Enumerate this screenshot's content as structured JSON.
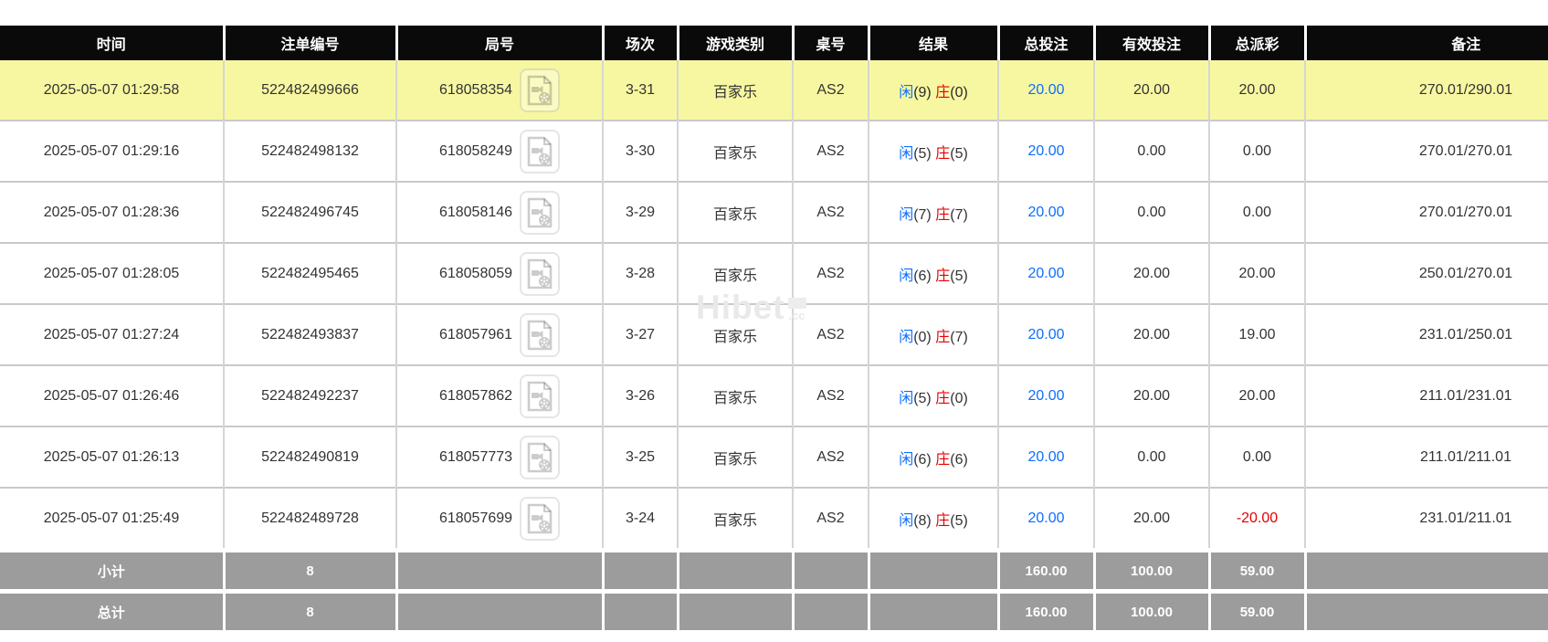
{
  "colors": {
    "header_bg": "#0a0a0a",
    "header_text": "#ffffff",
    "highlight_row": "#f7f7a1",
    "footer_bg": "#9c9c9c",
    "accent_blue": "#0d6efd",
    "accent_red": "#e60000",
    "body_text": "#333333"
  },
  "watermark": {
    "brand": "Hibet",
    "suffix": ".cc"
  },
  "table": {
    "columns": [
      "时间",
      "注单编号",
      "局号",
      "场次",
      "游戏类别",
      "桌号",
      "结果",
      "总投注",
      "有效投注",
      "总派彩",
      "备注"
    ],
    "result_labels": {
      "player": "闲",
      "banker": "庄"
    },
    "rows": [
      {
        "highlight": true,
        "time": "2025-05-07 01:29:58",
        "bet_no": "522482499666",
        "round_no": "618058354",
        "session": "3-31",
        "game_type": "百家乐",
        "table_no": "AS2",
        "player_score": "9",
        "banker_score": "0",
        "total_bet": "20.00",
        "valid_bet": "20.00",
        "payout": "20.00",
        "remark": "270.01/290.01"
      },
      {
        "highlight": false,
        "time": "2025-05-07 01:29:16",
        "bet_no": "522482498132",
        "round_no": "618058249",
        "session": "3-30",
        "game_type": "百家乐",
        "table_no": "AS2",
        "player_score": "5",
        "banker_score": "5",
        "total_bet": "20.00",
        "valid_bet": "0.00",
        "payout": "0.00",
        "remark": "270.01/270.01"
      },
      {
        "highlight": false,
        "time": "2025-05-07 01:28:36",
        "bet_no": "522482496745",
        "round_no": "618058146",
        "session": "3-29",
        "game_type": "百家乐",
        "table_no": "AS2",
        "player_score": "7",
        "banker_score": "7",
        "total_bet": "20.00",
        "valid_bet": "0.00",
        "payout": "0.00",
        "remark": "270.01/270.01"
      },
      {
        "highlight": false,
        "time": "2025-05-07 01:28:05",
        "bet_no": "522482495465",
        "round_no": "618058059",
        "session": "3-28",
        "game_type": "百家乐",
        "table_no": "AS2",
        "player_score": "6",
        "banker_score": "5",
        "total_bet": "20.00",
        "valid_bet": "20.00",
        "payout": "20.00",
        "remark": "250.01/270.01"
      },
      {
        "highlight": false,
        "time": "2025-05-07 01:27:24",
        "bet_no": "522482493837",
        "round_no": "618057961",
        "session": "3-27",
        "game_type": "百家乐",
        "table_no": "AS2",
        "player_score": "0",
        "banker_score": "7",
        "total_bet": "20.00",
        "valid_bet": "20.00",
        "payout": "19.00",
        "remark": "231.01/250.01"
      },
      {
        "highlight": false,
        "time": "2025-05-07 01:26:46",
        "bet_no": "522482492237",
        "round_no": "618057862",
        "session": "3-26",
        "game_type": "百家乐",
        "table_no": "AS2",
        "player_score": "5",
        "banker_score": "0",
        "total_bet": "20.00",
        "valid_bet": "20.00",
        "payout": "20.00",
        "remark": "211.01/231.01"
      },
      {
        "highlight": false,
        "time": "2025-05-07 01:26:13",
        "bet_no": "522482490819",
        "round_no": "618057773",
        "session": "3-25",
        "game_type": "百家乐",
        "table_no": "AS2",
        "player_score": "6",
        "banker_score": "6",
        "total_bet": "20.00",
        "valid_bet": "0.00",
        "payout": "0.00",
        "remark": "211.01/211.01"
      },
      {
        "highlight": false,
        "time": "2025-05-07 01:25:49",
        "bet_no": "522482489728",
        "round_no": "618057699",
        "session": "3-24",
        "game_type": "百家乐",
        "table_no": "AS2",
        "player_score": "8",
        "banker_score": "5",
        "total_bet": "20.00",
        "valid_bet": "20.00",
        "payout": "-20.00",
        "remark": "231.01/211.01"
      }
    ],
    "subtotal": {
      "label": "小计",
      "count": "8",
      "total_bet": "160.00",
      "valid_bet": "100.00",
      "payout": "59.00"
    },
    "total": {
      "label": "总计",
      "count": "8",
      "total_bet": "160.00",
      "valid_bet": "100.00",
      "payout": "59.00"
    }
  }
}
